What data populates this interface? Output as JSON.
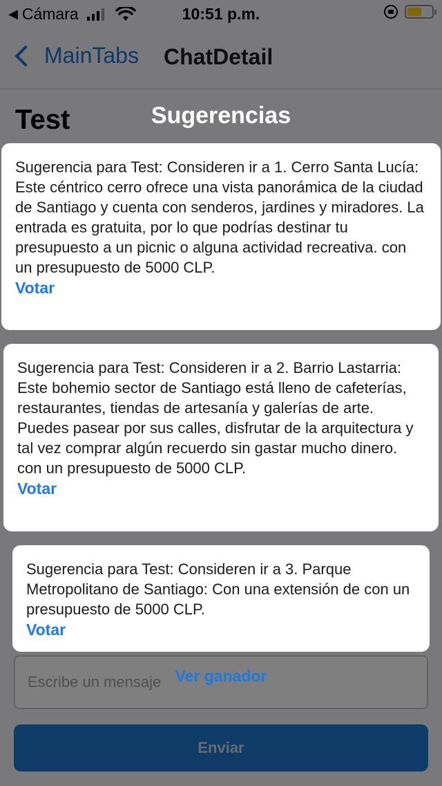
{
  "status_bar": {
    "carrier": "Cámara",
    "time": "10:51 p.m.",
    "battery_color": "#ffcc00"
  },
  "nav": {
    "back_label": "MainTabs",
    "title": "ChatDetail"
  },
  "page": {
    "heading": "Test",
    "message_placeholder": "Escribe un mensaje",
    "send_label": "Enviar"
  },
  "modal": {
    "title": "Sugerencias",
    "suggestions": [
      {
        "text": "Sugerencia para Test: Consideren ir a 1. Cerro Santa Lucía: Este céntrico cerro ofrece una vista panorámica de la ciudad de Santiago y cuenta con senderos, jardines y miradores. La entrada es gratuita, por lo que podrías destinar tu presupuesto a un picnic o alguna actividad recreativa. con un presupuesto de 5000 CLP.",
        "vote_label": "Votar"
      },
      {
        "text": "Sugerencia para Test: Consideren ir a 2. Barrio Lastarria: Este bohemio sector de Santiago está lleno de cafeterías, restaurantes, tiendas de artesanía y galerías de arte. Puedes pasear por sus calles, disfrutar de la arquitectura y tal vez comprar algún recuerdo sin gastar mucho dinero. con un presupuesto de 5000 CLP.",
        "vote_label": "Votar"
      },
      {
        "text": "Sugerencia para Test: Consideren ir a 3. Parque Metropolitano de Santiago: Con una extensión de con un presupuesto de 5000 CLP.",
        "vote_label": "Votar"
      }
    ],
    "winner_label": "Ver ganador"
  },
  "colors": {
    "accent": "#1e7ae0",
    "send_button": "#1f76d2",
    "overlay": "rgba(0,0,0,0.5)"
  }
}
